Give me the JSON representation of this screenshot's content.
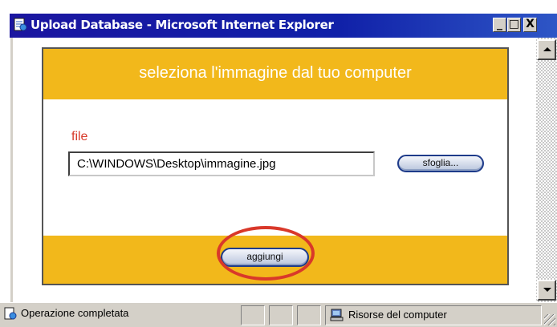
{
  "window": {
    "title": "Upload Database - Microsoft Internet Explorer",
    "controls": {
      "minimize": "_",
      "maximize": "□",
      "close": "X"
    }
  },
  "form": {
    "header_title": "seleziona l'immagine  dal tuo computer",
    "file_label": "file",
    "file_value": "C:\\WINDOWS\\Desktop\\immagine.jpg",
    "browse_label": "sfoglia...",
    "submit_label": "aggiungi"
  },
  "statusbar": {
    "status_text": "Operazione completata",
    "zone_text": "Risorse del computer"
  },
  "colors": {
    "header_bg": "#f2b81b",
    "title_bar": "#1b16a0",
    "label_red": "#d83a2a",
    "highlight": "#d9382a"
  },
  "icons": [
    "ie-page-icon",
    "scroll-up-icon",
    "scroll-down-icon",
    "done-page-icon",
    "my-computer-icon"
  ]
}
